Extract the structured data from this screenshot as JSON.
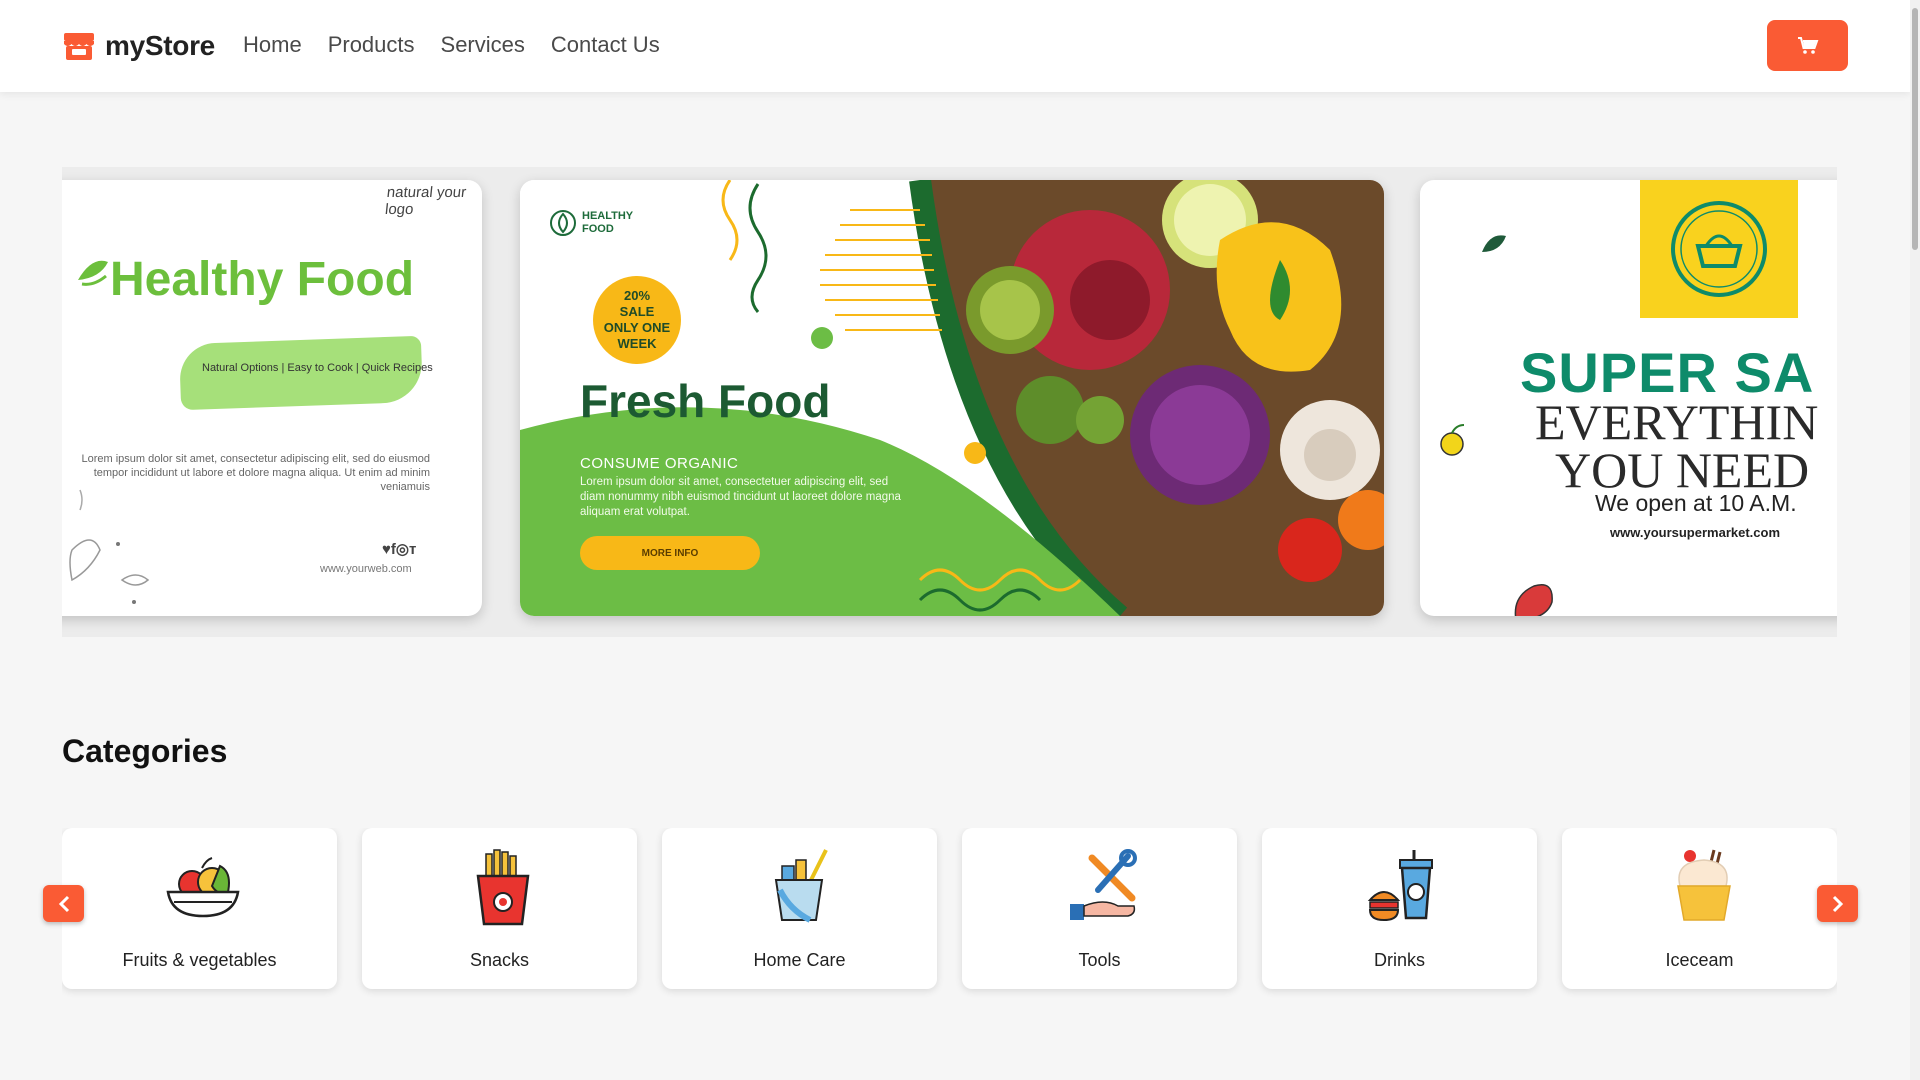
{
  "brand": {
    "name": "myStore",
    "icon": "store-icon",
    "color": "#fa5b34"
  },
  "nav": {
    "links": [
      "Home",
      "Products",
      "Services",
      "Contact Us"
    ]
  },
  "cart": {
    "icon": "cart-icon",
    "color": "#fa5b34"
  },
  "banners": {
    "healthy": {
      "logo": "natural your logo",
      "title": "Healthy Food",
      "options": "Natural Options | Easy to Cook | Quick Recipes",
      "lorem": "Lorem ipsum dolor sit amet, consectetur adipiscing elit, sed do eiusmod tempor incididunt ut labore et dolore magna aliqua. Ut enim ad minim veniamuis",
      "social": "♥f◎т",
      "web": "www.yourweb.com"
    },
    "fresh": {
      "brand": "HEALTHY FOOD",
      "sale": [
        "20%",
        "SALE",
        "ONLY ONE",
        "WEEK"
      ],
      "title": "Fresh Food",
      "subtitle": "CONSUME ORGANIC",
      "lorem": "Lorem ipsum dolor sit amet, consectetuer adipiscing elit, sed diam nonummy nibh euismod tincidunt ut laoreet dolore magna aliquam erat volutpat.",
      "button": "MORE INFO"
    },
    "super": {
      "title": "SUPER SA",
      "line1": "EVERYTHIN",
      "line2": "YOU NEED",
      "open": "We open at 10 A.M.",
      "web": "www.yoursupermarket.com"
    }
  },
  "categories": {
    "title": "Categories",
    "items": [
      {
        "label": "Fruits & vegetables",
        "icon": "fruit-bowl-icon"
      },
      {
        "label": "Snacks",
        "icon": "fries-icon"
      },
      {
        "label": "Home Care",
        "icon": "cleaning-supplies-icon"
      },
      {
        "label": "Tools",
        "icon": "tools-icon"
      },
      {
        "label": "Drinks",
        "icon": "drinks-icon"
      },
      {
        "label": "Iceceam",
        "icon": "cupcake-icon"
      }
    ]
  }
}
